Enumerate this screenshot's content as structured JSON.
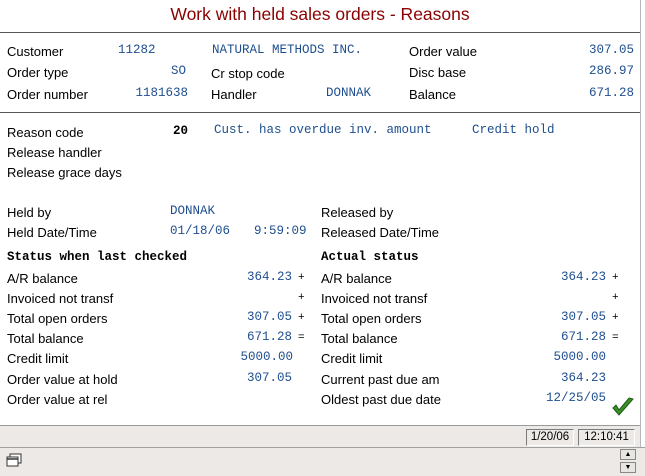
{
  "window": {
    "title": "Work with held sales orders - Reasons"
  },
  "header": {
    "customer_label": "Customer",
    "customer_no": "11282",
    "customer_name": "NATURAL METHODS INC.",
    "order_value_label": "Order value",
    "order_value": "307.05",
    "order_type_label": "Order type",
    "order_type": "SO",
    "cr_stop_label": "Cr stop code",
    "disc_base_label": "Disc base",
    "disc_base": "286.97",
    "order_number_label": "Order number",
    "order_number": "1181638",
    "handler_label": "Handler",
    "handler": "DONNAK",
    "balance_label": "Balance",
    "balance": "671.28"
  },
  "reason": {
    "reason_code_label": "Reason code",
    "reason_code": "20",
    "reason_text": "Cust. has overdue inv. amount",
    "reason_type": "Credit hold",
    "release_handler_label": "Release handler",
    "release_grace_label": "Release grace days"
  },
  "held": {
    "held_by_label": "Held by",
    "held_by": "DONNAK",
    "held_dt_label": "Held Date/Time",
    "held_date": "01/18/06",
    "held_time": "9:59:09",
    "released_by_label": "Released by",
    "released_dt_label": "Released Date/Time"
  },
  "last_checked": {
    "heading": "Status when last checked",
    "ar_label": "A/R balance",
    "ar": "364.23",
    "ar_sign": "+",
    "inv_label": "Invoiced not transf",
    "inv_sign": "+",
    "open_label": "Total open orders",
    "open": "307.05",
    "open_sign": "+",
    "total_label": "Total balance",
    "total": "671.28",
    "total_sign": "=",
    "limit_label": "Credit limit",
    "limit": "5000.00",
    "hold_label": "Order value at hold",
    "hold": "307.05",
    "rel_label": "Order value at rel"
  },
  "actual": {
    "heading": "Actual status",
    "ar_label": "A/R balance",
    "ar": "364.23",
    "ar_sign": "+",
    "inv_label": "Invoiced not transf",
    "inv_sign": "+",
    "open_label": "Total open orders",
    "open": "307.05",
    "open_sign": "+",
    "total_label": "Total balance",
    "total": "671.28",
    "total_sign": "=",
    "limit_label": "Credit limit",
    "limit": "5000.00",
    "past_due_label": "Current past due am",
    "past_due": "364.23",
    "oldest_label": "Oldest past due date",
    "oldest": "12/25/05"
  },
  "statusbar": {
    "date": "1/20/06",
    "time": "12:10:41"
  },
  "icons": {
    "confirm": "checkmark-icon",
    "window": "window-icon"
  },
  "colors": {
    "title": "#8b0000",
    "value": "#1f4f8f",
    "confirm": "#3a8f2a"
  }
}
